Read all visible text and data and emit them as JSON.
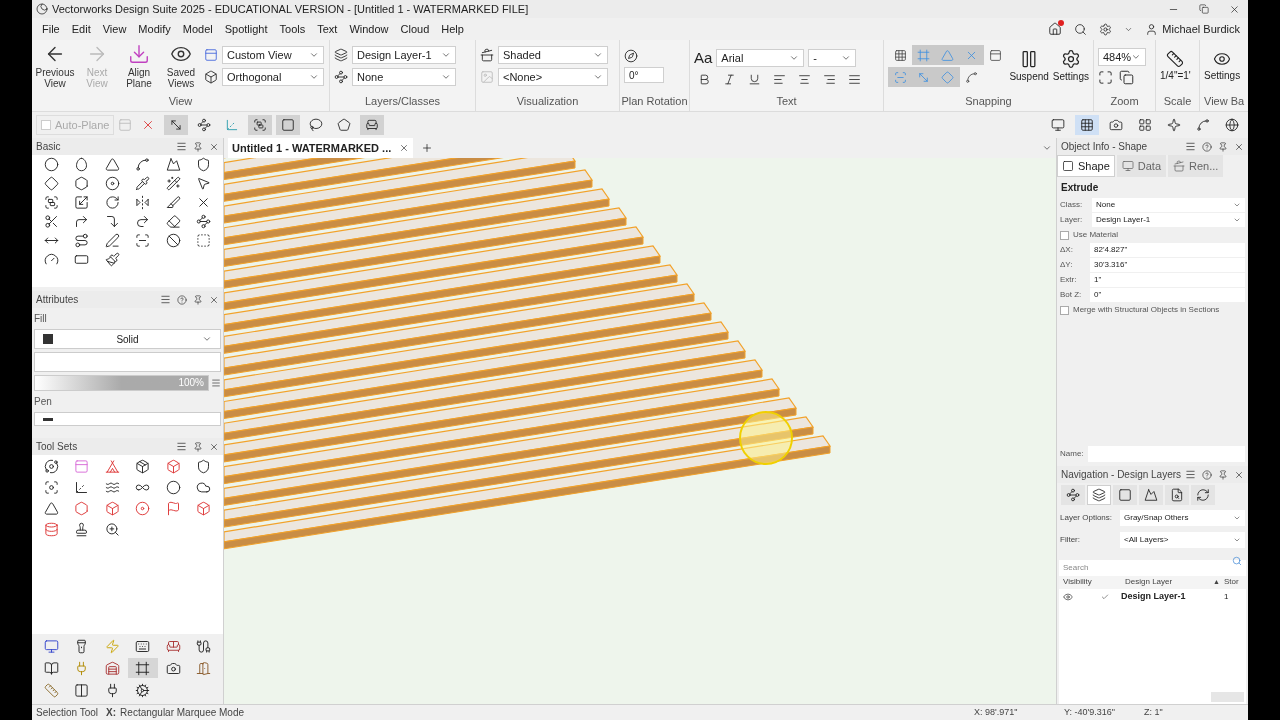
{
  "window": {
    "title": "Vectorworks Design Suite 2025 - EDUCATIONAL VERSION - [Untitled 1 - WATERMARKED FILE]",
    "user": "Michael Burdick",
    "notification": true
  },
  "menu": [
    "File",
    "Edit",
    "View",
    "Modify",
    "Model",
    "Spotlight",
    "Tools",
    "Text",
    "Window",
    "Cloud",
    "Help"
  ],
  "ribbon": {
    "view": {
      "title": "View",
      "buttons": [
        {
          "label": "Previous View",
          "disabled": false
        },
        {
          "label": "Next View",
          "disabled": true
        },
        {
          "label": "Align Plane",
          "disabled": false
        },
        {
          "label": "Saved Views",
          "disabled": false
        }
      ],
      "view_select": "Custom View",
      "projection_select": "Orthogonal"
    },
    "layers": {
      "title": "Layers/Classes",
      "layer_select": "Design Layer-1",
      "class_select": "None"
    },
    "visualization": {
      "title": "Visualization",
      "render_select": "Shaded",
      "light_select": "<None>"
    },
    "plan_rotation": {
      "title": "Plan Rotation",
      "value": "0°"
    },
    "text": {
      "title": "Text",
      "glyph": "Aa",
      "font": "Arial",
      "size": "-"
    },
    "snapping": {
      "title": "Snapping",
      "toggles": [
        {
          "on": false
        },
        {
          "on": true
        },
        {
          "on": true
        },
        {
          "on": true
        },
        {
          "on": false
        },
        {
          "on": true
        },
        {
          "on": true
        },
        {
          "on": true
        },
        {
          "on": false
        }
      ],
      "suspend": "Suspend",
      "settings": "Settings"
    },
    "zoom": {
      "title": "Zoom",
      "value": "484%"
    },
    "scale": {
      "title": "Scale",
      "value": "1/4\"=1'"
    },
    "view_bar": {
      "title": "View Ba",
      "settings": "Settings"
    }
  },
  "toolbar": {
    "auto_plane": {
      "label": "Auto-Plane",
      "checked": false
    },
    "modes": [
      {
        "selected": false
      },
      {
        "selected": true
      },
      {
        "selected": false
      },
      {
        "selected": false
      },
      {
        "selected": true
      },
      {
        "selected": true
      },
      {
        "selected": false
      },
      {
        "selected": false
      },
      {
        "selected": true
      }
    ],
    "right_tools": [
      {
        "selected": false
      },
      {
        "selected": true
      },
      {
        "selected": false
      },
      {
        "selected": false
      },
      {
        "selected": false
      },
      {
        "selected": false
      },
      {
        "selected": false
      }
    ]
  },
  "document_tabs": [
    {
      "label": "Untitled 1 - WATERMARKED ...",
      "selected": true
    }
  ],
  "basic_palette": {
    "title": "Basic"
  },
  "attributes": {
    "title": "Attributes",
    "fill_label": "Fill",
    "fill_style": "Solid",
    "opacity": "100%",
    "level": 1,
    "pen_label": "Pen"
  },
  "tool_sets": {
    "title": "Tool Sets",
    "tabs": [
      {
        "selected": false
      },
      {
        "selected": false
      },
      {
        "selected": false
      },
      {
        "selected": false
      },
      {
        "selected": false
      },
      {
        "selected": false
      },
      {
        "selected": false
      },
      {
        "selected": false
      },
      {
        "selected": false
      },
      {
        "selected": true
      },
      {
        "selected": false
      },
      {
        "selected": false
      },
      {
        "selected": false
      },
      {
        "selected": false
      },
      {
        "selected": false
      },
      {
        "selected": false
      }
    ]
  },
  "object_info": {
    "title": "Object Info - Shape",
    "tabs": [
      {
        "label": "Shape",
        "selected": true
      },
      {
        "label": "Data",
        "selected": false
      },
      {
        "label": "Ren...",
        "selected": false
      }
    ],
    "object_type": "Extrude",
    "fields": [
      {
        "kind": "select",
        "label": "Class:",
        "value": "None"
      },
      {
        "kind": "select",
        "label": "Layer:",
        "value": "Design Layer-1"
      },
      {
        "kind": "checkbox",
        "label": "Use Material",
        "checked": false
      },
      {
        "kind": "text",
        "label": "ΔX:",
        "value": "82'4.827\""
      },
      {
        "kind": "text",
        "label": "ΔY:",
        "value": "30'3.316\""
      },
      {
        "kind": "text",
        "label": "Extr:",
        "value": "1\""
      },
      {
        "kind": "text",
        "label": "Bot Z:",
        "value": "0\""
      },
      {
        "kind": "checkbox",
        "label": "Merge with Structural Objects in Sections",
        "checked": false
      }
    ],
    "name_label": "Name:"
  },
  "navigation": {
    "title": "Navigation - Design Layers",
    "nav_tabs": [
      {
        "selected": false
      },
      {
        "selected": true
      },
      {
        "selected": false
      },
      {
        "selected": false
      },
      {
        "selected": false
      },
      {
        "selected": false
      }
    ],
    "layer_options_label": "Layer Options:",
    "layer_options": "Gray/Snap Others",
    "filter_label": "Filter:",
    "filter": "<All Layers>",
    "search_placeholder": "Search",
    "columns": [
      "Visibility",
      "Design Layer",
      "Stor"
    ],
    "sort_glyph": "▲",
    "rows": [
      {
        "name": "Design Layer-1",
        "stack": "1",
        "visible": true,
        "active": true
      }
    ]
  },
  "status_bar": {
    "tool": "Selection Tool",
    "mode_key": "X:",
    "mode": "Rectangular Marquee Mode",
    "x": "X: 98'.971\"",
    "y": "Y: -40'9.316\"",
    "z": "Z: 1\""
  }
}
